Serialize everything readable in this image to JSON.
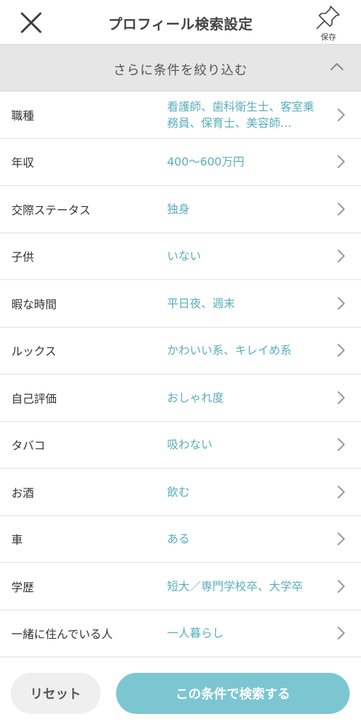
{
  "header": {
    "title": "プロフィール検索設定",
    "save_label": "保存"
  },
  "refine": {
    "label": "さらに条件を絞り込む"
  },
  "conditions": [
    {
      "label": "職種",
      "value": "看護師、歯科衛生士、客室乗務員、保育士、美容師…"
    },
    {
      "label": "年収",
      "value": "400～600万円"
    },
    {
      "label": "交際ステータス",
      "value": "独身"
    },
    {
      "label": "子供",
      "value": "いない"
    },
    {
      "label": "暇な時間",
      "value": "平日夜、週末"
    },
    {
      "label": "ルックス",
      "value": "かわいい系、キレイめ系"
    },
    {
      "label": "自己評価",
      "value": "おしゃれ度"
    },
    {
      "label": "タバコ",
      "value": "吸わない"
    },
    {
      "label": "お酒",
      "value": "飲む"
    },
    {
      "label": "車",
      "value": "ある"
    },
    {
      "label": "学歴",
      "value": "短大／専門学校卒、大学卒"
    },
    {
      "label": "一緒に住んでいる人",
      "value": "一人暮らし"
    }
  ],
  "footer": {
    "reset_label": "リセット",
    "search_label": "この条件で検索する"
  },
  "colors": {
    "accent": "#7cc6d2",
    "value_text": "#5aaebc",
    "section_bg": "#e6e6e6"
  }
}
